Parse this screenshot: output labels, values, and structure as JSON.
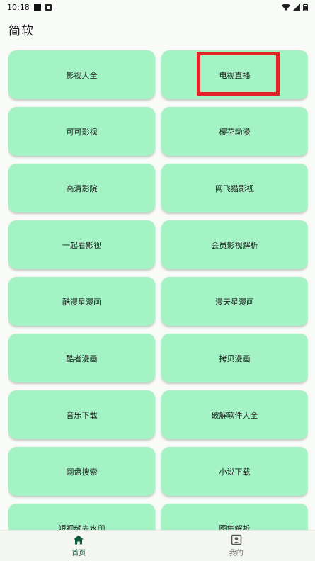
{
  "status_bar": {
    "time": "10:18",
    "left_icons": [
      "notification-square-icon",
      "app-a-icon"
    ],
    "right_icons": [
      "wifi-icon",
      "signal-icon",
      "battery-icon"
    ]
  },
  "app_bar": {
    "title": "简软"
  },
  "grid": {
    "items": [
      {
        "label": "影视大全"
      },
      {
        "label": "电视直播",
        "highlighted": true
      },
      {
        "label": "可可影视"
      },
      {
        "label": "樱花动漫"
      },
      {
        "label": "高清影院"
      },
      {
        "label": "网飞猫影视"
      },
      {
        "label": "一起看影视"
      },
      {
        "label": "会员影视解析"
      },
      {
        "label": "酷漫星漫画"
      },
      {
        "label": "漫天星漫画"
      },
      {
        "label": "酷者漫画"
      },
      {
        "label": "拷贝漫画"
      },
      {
        "label": "音乐下载"
      },
      {
        "label": "破解软件大全"
      },
      {
        "label": "网盘搜索"
      },
      {
        "label": "小说下载"
      },
      {
        "label": "短视频去水印"
      },
      {
        "label": "图集解析"
      }
    ]
  },
  "bottom_nav": {
    "items": [
      {
        "label": "首页",
        "icon": "home-icon",
        "active": true
      },
      {
        "label": "我的",
        "icon": "profile-icon",
        "active": false
      }
    ]
  },
  "colors": {
    "card_bg": "#a3f3c4",
    "highlight_border": "#e0242a",
    "nav_active": "#0f5a3a",
    "background": "#f9fbf8"
  }
}
